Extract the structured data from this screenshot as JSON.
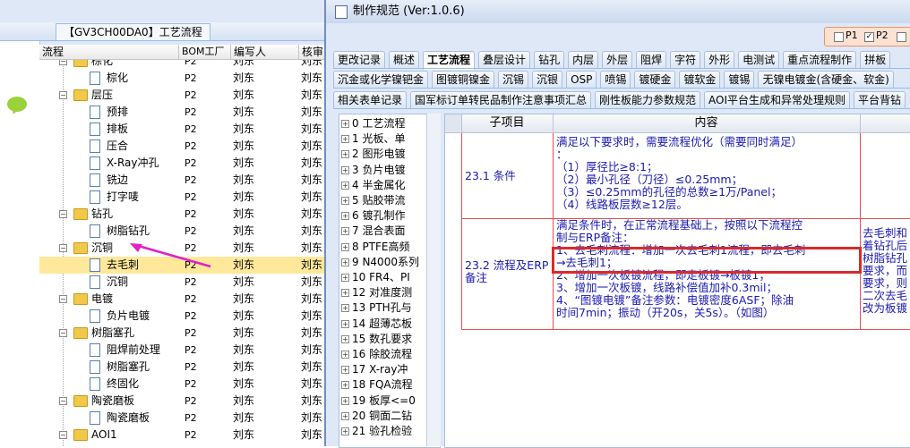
{
  "left_window": {
    "title": "【GV3CH00DA0】工艺流程",
    "columns": [
      "流程",
      "BOM工厂",
      "编写人",
      "核审"
    ],
    "rows": [
      {
        "name": "棕化",
        "type": "folder",
        "bom": "P2",
        "author": "刘东",
        "review": "刘东"
      },
      {
        "name": "棕化",
        "type": "doc",
        "bom": "P2",
        "author": "刘东",
        "review": "刘东"
      },
      {
        "name": "层压",
        "type": "folder",
        "bom": "P2",
        "author": "刘东",
        "review": "刘东"
      },
      {
        "name": "预排",
        "type": "doc",
        "bom": "P2",
        "author": "刘东",
        "review": "刘东"
      },
      {
        "name": "排板",
        "type": "doc",
        "bom": "P2",
        "author": "刘东",
        "review": "刘东"
      },
      {
        "name": "压合",
        "type": "doc",
        "bom": "P2",
        "author": "刘东",
        "review": "刘东"
      },
      {
        "name": "X-Ray冲孔",
        "type": "doc",
        "bom": "P2",
        "author": "刘东",
        "review": "刘东"
      },
      {
        "name": "铣边",
        "type": "doc",
        "bom": "P2",
        "author": "刘东",
        "review": "刘东"
      },
      {
        "name": "打字唛",
        "type": "doc",
        "bom": "P2",
        "author": "刘东",
        "review": "刘东"
      },
      {
        "name": "钻孔",
        "type": "folder",
        "bom": "P2",
        "author": "刘东",
        "review": "刘东"
      },
      {
        "name": "树脂钻孔",
        "type": "doc",
        "bom": "P2",
        "author": "刘东",
        "review": "刘东"
      },
      {
        "name": "沉铜",
        "type": "folder",
        "bom": "P2",
        "author": "刘东",
        "review": "刘东"
      },
      {
        "name": "去毛刺",
        "type": "doc",
        "bom": "P2",
        "author": "刘东",
        "review": "刘东",
        "selected": true
      },
      {
        "name": "沉铜",
        "type": "doc",
        "bom": "P2",
        "author": "刘东",
        "review": "刘东"
      },
      {
        "name": "电镀",
        "type": "folder",
        "bom": "P2",
        "author": "刘东",
        "review": "刘东"
      },
      {
        "name": "负片电镀",
        "type": "doc",
        "bom": "P2",
        "author": "刘东",
        "review": "刘东"
      },
      {
        "name": "树脂塞孔",
        "type": "folder",
        "bom": "P2",
        "author": "刘东",
        "review": "刘东"
      },
      {
        "name": "阻焊前处理",
        "type": "doc",
        "bom": "P2",
        "author": "刘东",
        "review": "刘东"
      },
      {
        "name": "树脂塞孔",
        "type": "doc",
        "bom": "P2",
        "author": "刘东",
        "review": "刘东"
      },
      {
        "name": "终固化",
        "type": "doc",
        "bom": "P2",
        "author": "刘东",
        "review": "刘东"
      },
      {
        "name": "陶瓷磨板",
        "type": "folder",
        "bom": "P2",
        "author": "刘东",
        "review": "刘东"
      },
      {
        "name": "陶瓷磨板",
        "type": "doc",
        "bom": "P2",
        "author": "刘东",
        "review": "刘东"
      },
      {
        "name": "AOI1",
        "type": "folder",
        "bom": "P2",
        "author": "刘东",
        "review": "刘东"
      }
    ]
  },
  "right_window": {
    "title": "制作规范 (Ver:1.0.6)",
    "toggles": [
      {
        "label": "P1",
        "checked": false
      },
      {
        "label": "P2",
        "checked": true
      }
    ],
    "tabs_row1": [
      "更改记录",
      "概述",
      "工艺流程",
      "叠层设计",
      "钻孔",
      "内层",
      "外层",
      "阻焊",
      "字符",
      "外形",
      "电测试",
      "重点流程制作",
      "拼板"
    ],
    "active_tab": "工艺流程",
    "tabs_row2": [
      "沉金或化学镍钯金",
      "图镀铜镍金",
      "沉锡",
      "沉银",
      "OSP",
      "喷锡",
      "镀硬金",
      "镀软金",
      "镀锡",
      "无镍电镀金(含硬金、软金)"
    ],
    "tabs_row3": [
      "相关表单记录",
      "国军标订单转民品制作注意事项汇总",
      "刚性板能力参数规范",
      "AOI平台生成和异常处理规则",
      "平台背钻"
    ],
    "tree_items": [
      "0 工艺流程",
      "1 光板、单",
      "2 图形电镀",
      "3 负片电镀",
      "4 半金属化",
      "5 贴胶带流",
      "6 镀孔制作",
      "7 混合表面",
      "8 PTFE高频",
      "9 N4000系列",
      "10 FR4、PI",
      "12 对准度测",
      "13 PTH孔与",
      "14 超薄芯板",
      "15 数孔要求",
      "16 除胶流程",
      "17 X-ray冲",
      "18 FQA流程",
      "19 板厚<=0",
      "20 铜面二钻",
      "21 验孔检验"
    ],
    "grid": {
      "col_subitem": "子项目",
      "col_content": "内容",
      "rows": [
        {
          "subitem": "23.1 条件",
          "content": [
            "满足以下要求时，需要流程优化（需要同时满足）",
            "：",
            "（1）厚径比≥8:1；",
            "（2）最小孔径（刀径）≤0.25mm；",
            "（3）≤0.25mm的孔径的总数≥1万/Panel；",
            "（4）线路板层数≥12层。"
          ],
          "extra": []
        },
        {
          "subitem": "23.2 流程及ERP备注",
          "content": [
            "满足条件时，在正常流程基础上，按照以下流程控",
            "制与ERP备注：",
            "1、去毛刺流程：增加一次去毛刺1流程，即去毛刺",
            "→去毛刺1；",
            "2、增加一次板镀流程，即走板镀→板镀1；",
            "3、增加一次板镀，线路补偿值加补0.3mil；",
            "4、“图镀电镀”备注参数：电镀密度6ASF；除油",
            "时间7min；振动（开20s，关5s）。（如图）"
          ],
          "extra": [
            "去毛刺和",
            "着钻孔后",
            "树脂钻孔",
            "要求，而",
            "要求，则",
            "二次去毛",
            "改为板镀"
          ]
        }
      ]
    }
  },
  "colors": {
    "selection": "#ffe89a",
    "highlight_box": "#d92b2b",
    "arrow": "#e020c8",
    "content_text": "#1a1ab0"
  }
}
